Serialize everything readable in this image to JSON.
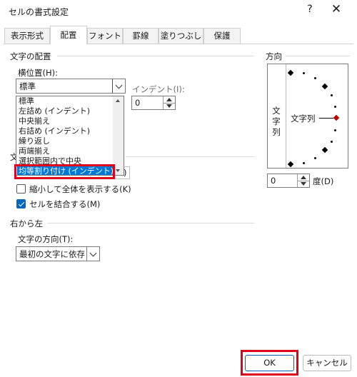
{
  "window": {
    "title": "セルの書式設定",
    "help": "?",
    "close": "✕"
  },
  "tabs": [
    {
      "label": "表示形式",
      "active": false
    },
    {
      "label": "配置",
      "active": true
    },
    {
      "label": "フォント",
      "active": false
    },
    {
      "label": "罫線",
      "active": false
    },
    {
      "label": "塗りつぶし",
      "active": false
    },
    {
      "label": "保護",
      "active": false
    }
  ],
  "text_alignment": {
    "heading": "文字の配置",
    "horizontal_label": "横位置(H):",
    "horizontal_value": "標準",
    "indent_label": "インデント(I):",
    "indent_value": "0",
    "dropdown_options": [
      "標準",
      "左詰め (インデント)",
      "中央揃え",
      "右詰め (インデント)",
      "繰り返し",
      "両端揃え",
      "選択範囲内で中央",
      "均等割り付け (インデント)"
    ],
    "selected_option_index": 7,
    "hidden_heading_start": "文",
    "hidden_combo_tail": ")"
  },
  "text_control": {
    "shrink_to_fit": {
      "label": "縮小して全体を表示する(K)",
      "checked": false
    },
    "merge_cells": {
      "label": "セルを結合する(M)",
      "checked": true
    }
  },
  "rtl": {
    "heading": "右から左",
    "direction_label": "文字の方向(T):",
    "direction_value": "最初の文字に依存"
  },
  "orientation": {
    "heading": "方向",
    "vertical_text": [
      "文",
      "字",
      "列"
    ],
    "horizontal_text": "文字列",
    "degree_value": "0",
    "degree_label": "度(D)"
  },
  "buttons": {
    "ok": "OK",
    "cancel": "キャンセル"
  },
  "colors": {
    "accent": "#0078d7",
    "highlight_red": "#e0001b",
    "checkbox_checked": "#0067c0",
    "orientation_marker": "#c00000"
  }
}
